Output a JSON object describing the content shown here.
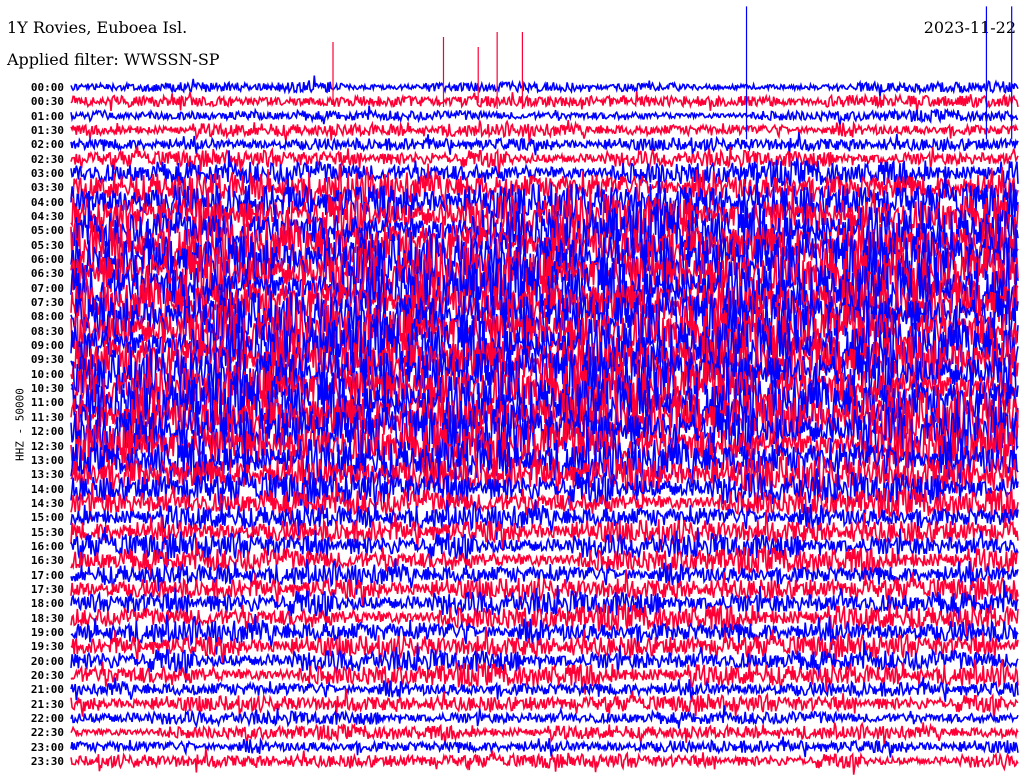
{
  "chart_data": {
    "type": "line",
    "title": "1Y Rovies, Euboea Isl.",
    "date": "2023-11-22",
    "filter_label": "Applied filter: WWSSN-SP",
    "channel_label": "HHZ - 50000",
    "minutes_per_line": 30,
    "row_labels": [
      "00:00",
      "00:30",
      "01:00",
      "01:30",
      "02:00",
      "02:30",
      "03:00",
      "03:30",
      "04:00",
      "04:30",
      "05:00",
      "05:30",
      "06:00",
      "06:30",
      "07:00",
      "07:30",
      "08:00",
      "08:30",
      "09:00",
      "09:30",
      "10:00",
      "10:30",
      "11:00",
      "11:30",
      "12:00",
      "12:30",
      "13:00",
      "13:30",
      "14:00",
      "14:30",
      "15:00",
      "15:30",
      "16:00",
      "16:30",
      "17:00",
      "17:30",
      "18:00",
      "18:30",
      "19:00",
      "19:30",
      "20:00",
      "20:30",
      "21:00",
      "21:30",
      "22:00",
      "22:30",
      "23:00",
      "23:30"
    ],
    "relative_amplitude": [
      4,
      5,
      4,
      5,
      5,
      6,
      9,
      12,
      14,
      16,
      18,
      19,
      20,
      20,
      20,
      19,
      19,
      20,
      20,
      20,
      20,
      20,
      20,
      20,
      19,
      18,
      16,
      14,
      12,
      10,
      9,
      9,
      9,
      9,
      8,
      8,
      9,
      9,
      9,
      8,
      8,
      8,
      6,
      6,
      5,
      5,
      5,
      5
    ],
    "spikes": [
      {
        "row": 0,
        "minute": 8.3,
        "height": 45
      },
      {
        "row": 0,
        "minute": 11.8,
        "height": 50
      },
      {
        "row": 0,
        "minute": 12.9,
        "height": 40
      },
      {
        "row": 0,
        "minute": 13.5,
        "height": 55
      },
      {
        "row": 0,
        "minute": 14.3,
        "height": 55
      },
      {
        "row": 1,
        "minute": 21.4,
        "height": 95
      },
      {
        "row": 1,
        "minute": 29.0,
        "height": 95
      },
      {
        "row": 1,
        "minute": 29.8,
        "height": 95
      }
    ],
    "colors": {
      "even_rows": "#0000ff",
      "odd_rows": "#ff0036"
    }
  }
}
